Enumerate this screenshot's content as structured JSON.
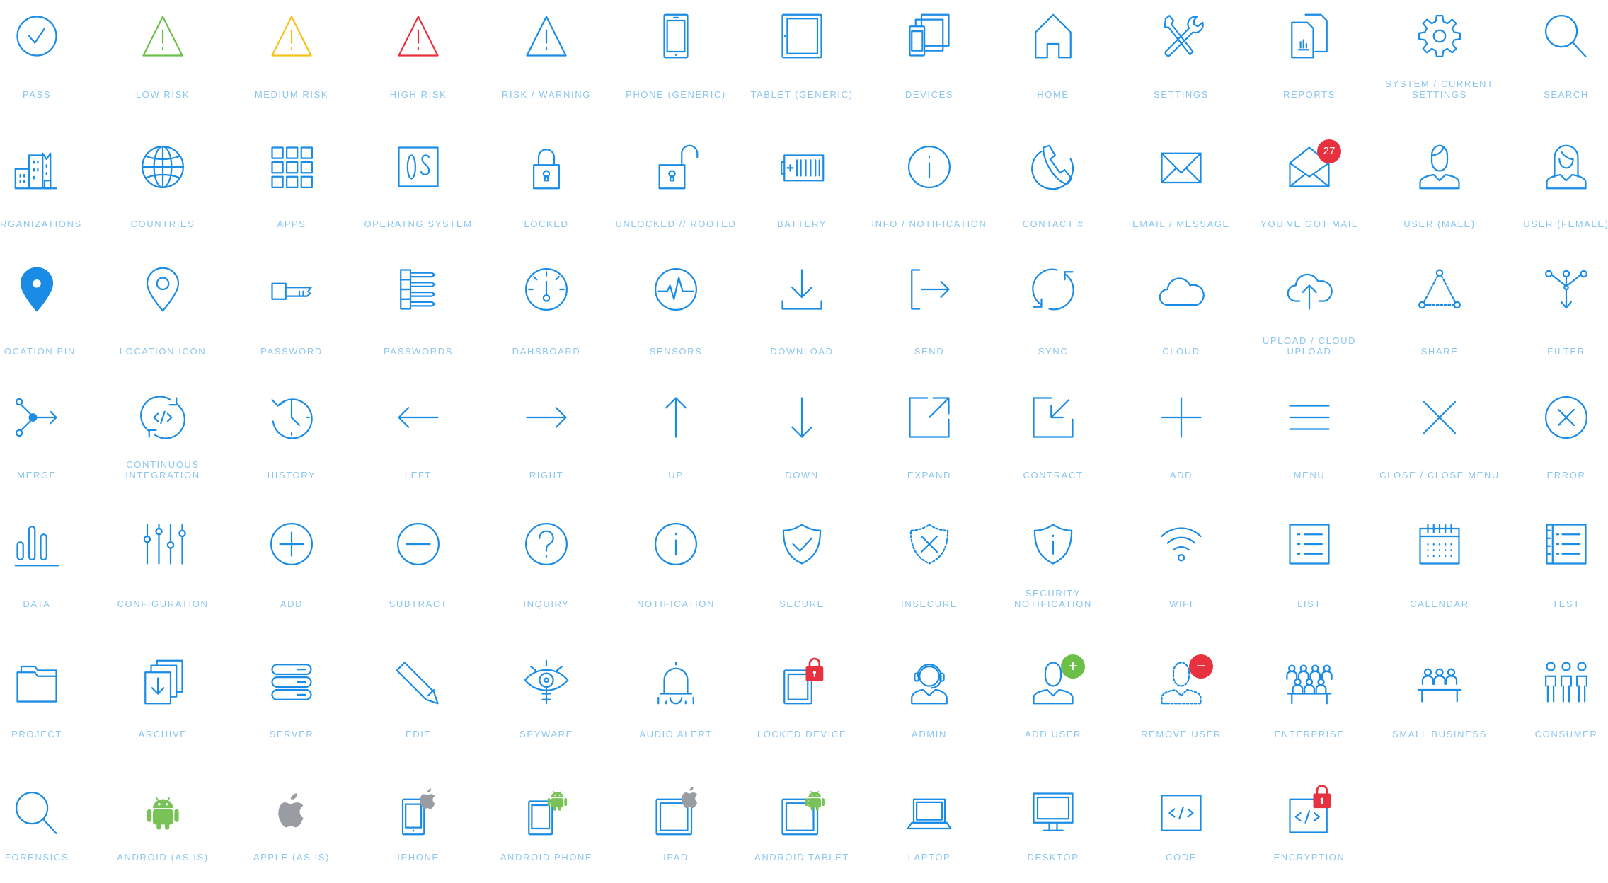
{
  "colors": {
    "blue": "#1a8ce6",
    "green": "#6cc04a",
    "yellow": "#f5c21b",
    "red": "#e8313f",
    "gray": "#9a9ca3",
    "label": "#8cc6ef"
  },
  "rows": [
    [
      {
        "label": "Pass",
        "icon": "circle-check"
      },
      {
        "label": "Low Risk",
        "icon": "warning",
        "color": "green"
      },
      {
        "label": "Medium Risk",
        "icon": "warning",
        "color": "yellow"
      },
      {
        "label": "High Risk",
        "icon": "warning",
        "color": "red"
      },
      {
        "label": "Risk / Warning",
        "icon": "warning"
      },
      {
        "label": "Phone (Generic)",
        "icon": "phone"
      },
      {
        "label": "Tablet (Generic)",
        "icon": "tablet"
      },
      {
        "label": "Devices",
        "icon": "devices"
      },
      {
        "label": "Home",
        "icon": "home"
      },
      {
        "label": "Settings",
        "icon": "tools"
      },
      {
        "label": "Reports",
        "icon": "reports"
      },
      {
        "label": "System / Current\nSettings",
        "icon": "gear"
      },
      {
        "label": "Search",
        "icon": "search"
      }
    ],
    [
      {
        "label": "Organizations",
        "icon": "building"
      },
      {
        "label": "Countries",
        "icon": "globe"
      },
      {
        "label": "Apps",
        "icon": "apps"
      },
      {
        "label": "Operatng System",
        "icon": "os"
      },
      {
        "label": "Locked",
        "icon": "lock"
      },
      {
        "label": "Unlocked // Rooted",
        "icon": "unlock"
      },
      {
        "label": "Battery",
        "icon": "battery"
      },
      {
        "label": "Info / Notification",
        "icon": "circle-info"
      },
      {
        "label": "Contact #",
        "icon": "contact"
      },
      {
        "label": "Email / Message",
        "icon": "mail"
      },
      {
        "label": "You've Got Mail",
        "icon": "mail-open",
        "badge": "27",
        "badge_color": "red"
      },
      {
        "label": "User (Male)",
        "icon": "user-male"
      },
      {
        "label": "User (Female)",
        "icon": "user-female"
      }
    ],
    [
      {
        "label": "Location Pin",
        "icon": "pin-filled"
      },
      {
        "label": "Location Icon",
        "icon": "pin"
      },
      {
        "label": "Password",
        "icon": "key"
      },
      {
        "label": "Passwords",
        "icon": "keys"
      },
      {
        "label": "Dahsboard",
        "icon": "dashboard"
      },
      {
        "label": "Sensors",
        "icon": "sensors"
      },
      {
        "label": "Download",
        "icon": "download"
      },
      {
        "label": "Send",
        "icon": "send"
      },
      {
        "label": "Sync",
        "icon": "sync"
      },
      {
        "label": "Cloud",
        "icon": "cloud"
      },
      {
        "label": "Upload / Cloud\nUpload",
        "icon": "cloud-upload"
      },
      {
        "label": "Share",
        "icon": "share"
      },
      {
        "label": "Filter",
        "icon": "filter"
      }
    ],
    [
      {
        "label": "Merge",
        "icon": "merge"
      },
      {
        "label": "Continuous\nIntegration",
        "icon": "ci"
      },
      {
        "label": "History",
        "icon": "history"
      },
      {
        "label": "Left",
        "icon": "arrow-left"
      },
      {
        "label": "Right",
        "icon": "arrow-right"
      },
      {
        "label": "Up",
        "icon": "arrow-up"
      },
      {
        "label": "Down",
        "icon": "arrow-down"
      },
      {
        "label": "Expand",
        "icon": "expand"
      },
      {
        "label": "Contract",
        "icon": "contract"
      },
      {
        "label": "Add",
        "icon": "plus"
      },
      {
        "label": "Menu",
        "icon": "menu"
      },
      {
        "label": "Close / Close Menu",
        "icon": "close"
      },
      {
        "label": "Error",
        "icon": "circle-x"
      }
    ],
    [
      {
        "label": "Data",
        "icon": "data"
      },
      {
        "label": "Configuration",
        "icon": "sliders"
      },
      {
        "label": "Add",
        "icon": "circle-plus"
      },
      {
        "label": "Subtract",
        "icon": "circle-minus"
      },
      {
        "label": "Inquiry",
        "icon": "circle-question"
      },
      {
        "label": "Notification",
        "icon": "circle-info"
      },
      {
        "label": "Secure",
        "icon": "shield-check"
      },
      {
        "label": "Insecure",
        "icon": "shield-x"
      },
      {
        "label": "Security\nNotification",
        "icon": "shield-info"
      },
      {
        "label": "WiFi",
        "icon": "wifi"
      },
      {
        "label": "List",
        "icon": "list"
      },
      {
        "label": "Calendar",
        "icon": "calendar"
      },
      {
        "label": "Test",
        "icon": "test"
      }
    ],
    [
      {
        "label": "Project",
        "icon": "folder"
      },
      {
        "label": "Archive",
        "icon": "archive"
      },
      {
        "label": "Server",
        "icon": "server"
      },
      {
        "label": "Edit",
        "icon": "pencil"
      },
      {
        "label": "Spyware",
        "icon": "eye"
      },
      {
        "label": "Audio Alert",
        "icon": "bell"
      },
      {
        "label": "Locked Device",
        "icon": "locked-device"
      },
      {
        "label": "Admin",
        "icon": "admin"
      },
      {
        "label": "Add User",
        "icon": "add-user"
      },
      {
        "label": "Remove User",
        "icon": "remove-user"
      },
      {
        "label": "Enterprise",
        "icon": "enterprise"
      },
      {
        "label": "Small Business",
        "icon": "small-business"
      },
      {
        "label": "Consumer",
        "icon": "consumer"
      }
    ],
    [
      {
        "label": "Forensics",
        "icon": "search"
      },
      {
        "label": "Android (As Is)",
        "icon": "android"
      },
      {
        "label": "Apple (As Is)",
        "icon": "apple"
      },
      {
        "label": "iPhone",
        "icon": "iphone"
      },
      {
        "label": "Android Phone",
        "icon": "android-phone"
      },
      {
        "label": "iPad",
        "icon": "ipad"
      },
      {
        "label": "Android Tablet",
        "icon": "android-tablet"
      },
      {
        "label": "Laptop",
        "icon": "laptop"
      },
      {
        "label": "Desktop",
        "icon": "desktop"
      },
      {
        "label": "Code",
        "icon": "code"
      },
      {
        "label": "Encryption",
        "icon": "encryption"
      }
    ]
  ]
}
